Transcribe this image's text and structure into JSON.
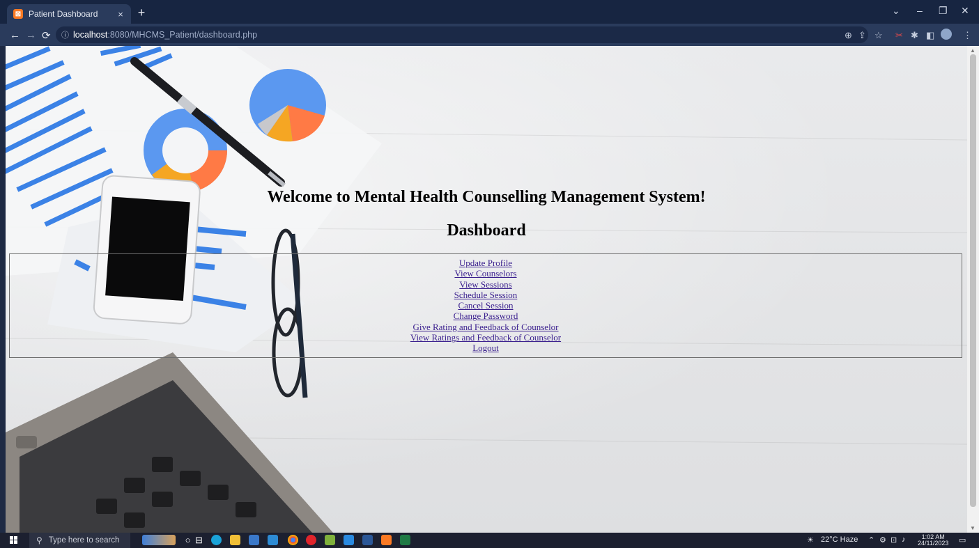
{
  "browser": {
    "tab_title": "Patient Dashboard",
    "tab_close": "×",
    "new_tab": "+",
    "url_host": "localhost",
    "url_path": ":8080/MHCMS_Patient/dashboard.php",
    "window_controls": {
      "collapse": "⌄",
      "minimize": "–",
      "restore": "❐",
      "close": "✕"
    }
  },
  "page": {
    "welcome_heading": "Welcome to Mental Health Counselling Management System!",
    "dashboard_heading": "Dashboard",
    "menu": [
      {
        "label": "Update Profile"
      },
      {
        "label": "View Counselors"
      },
      {
        "label": "View Sessions"
      },
      {
        "label": "Schedule Session"
      },
      {
        "label": "Cancel Session"
      },
      {
        "label": "Change Password"
      },
      {
        "label": "Give Rating and Feedback of Counselor"
      },
      {
        "label": "View Ratings and Feedback of Counselor"
      },
      {
        "label": "Logout"
      }
    ]
  },
  "taskbar": {
    "search_placeholder": "Type here to search",
    "weather": "22°C  Haze",
    "time": "1:02 AM",
    "date": "24/11/2023"
  },
  "colors": {
    "chrome_dark": "#172541",
    "chrome_toolbar": "#2a3b5c",
    "link": "#3a1f8e",
    "xampp_orange": "#fb7a24"
  }
}
